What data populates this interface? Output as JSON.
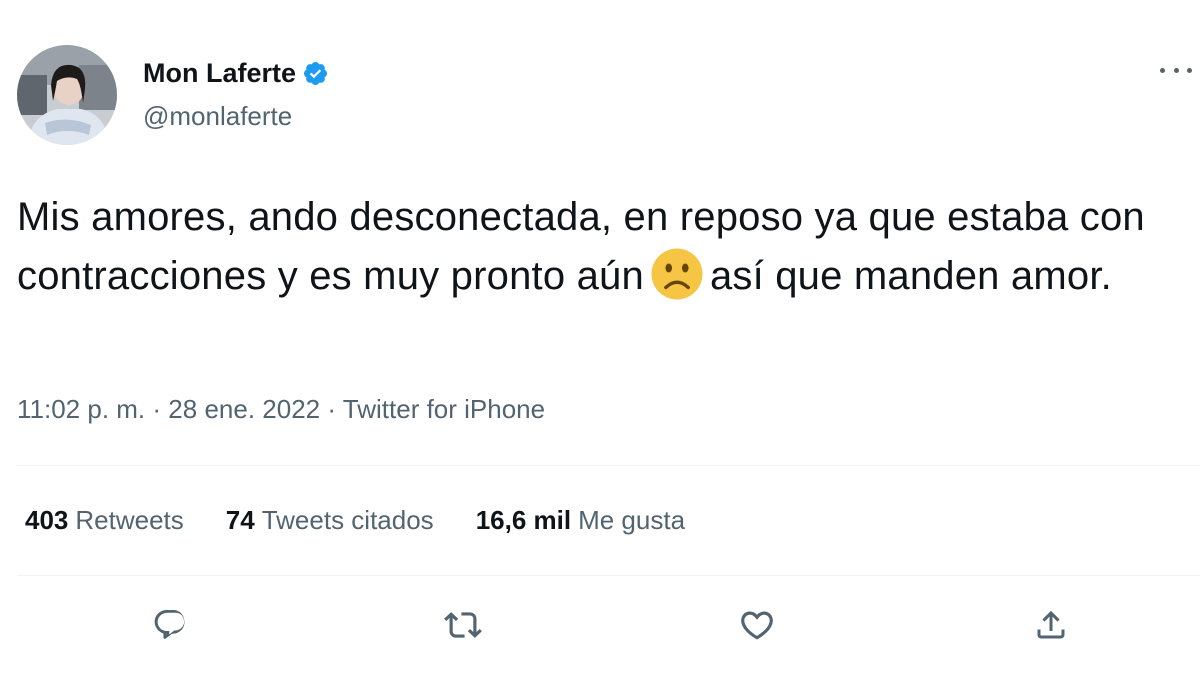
{
  "author": {
    "name": "Mon Laferte",
    "handle": "@monlaferte",
    "verified": true
  },
  "tweet": {
    "text_part1": "Mis amores, ando desconectada, en reposo ya que estaba con contracciones y es muy pronto aún",
    "emoji": "🙁",
    "text_part2": "así que manden amor."
  },
  "meta": {
    "time": "11:02 p. m.",
    "separator1": "·",
    "date": "28 ene. 2022",
    "separator2": "·",
    "source": "Twitter for iPhone"
  },
  "stats": [
    {
      "count": "403",
      "label": "Retweets"
    },
    {
      "count": "74",
      "label": "Tweets citados"
    },
    {
      "count": "16,6 mil",
      "label": "Me gusta"
    }
  ],
  "actions": [
    "reply-icon",
    "retweet-icon",
    "like-icon",
    "share-icon"
  ],
  "colors": {
    "text": "#0f1419",
    "secondary": "#536471",
    "verified": "#1d9bf0",
    "divider": "#eff3f4",
    "emoji": "#f6c544"
  }
}
